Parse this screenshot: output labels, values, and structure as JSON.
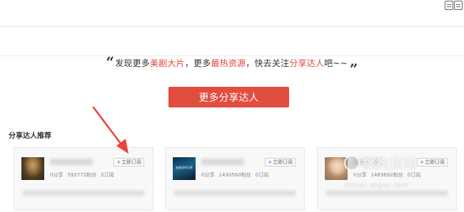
{
  "promo": {
    "open_quote": "“",
    "part1": "发现更多",
    "highlight1": "美剧大片",
    "part2": "，更多",
    "highlight2": "最热资源",
    "part3": "，快去关注",
    "highlight3": "分享达人",
    "part4": "吧~~",
    "close_quote": "”"
  },
  "more_button": "更多分享达人",
  "section_title": "分享达人推荐",
  "subscribe_label": "立即订阅",
  "cards": [
    {
      "shares": "0分享",
      "fans": "592772粉丝",
      "subs": "2订阅"
    },
    {
      "avatar_text": "最美丽的风景",
      "shares": "0分享",
      "fans": "1430560粉丝",
      "subs": "0订阅"
    },
    {
      "shares": "0分享",
      "fans": "1483692粉丝",
      "subs": "0订阅"
    }
  ],
  "watermark": {
    "cn": "搜狗指南",
    "en": "zhinan.sogou.com"
  },
  "colors": {
    "accent": "#e14d3e",
    "highlight": "#e0453d",
    "subscribe_plus": "#3a8ee6",
    "arrow": "#e8443a"
  },
  "icons": [
    "calendar-icon",
    "grid-icon",
    "plus-icon"
  ]
}
